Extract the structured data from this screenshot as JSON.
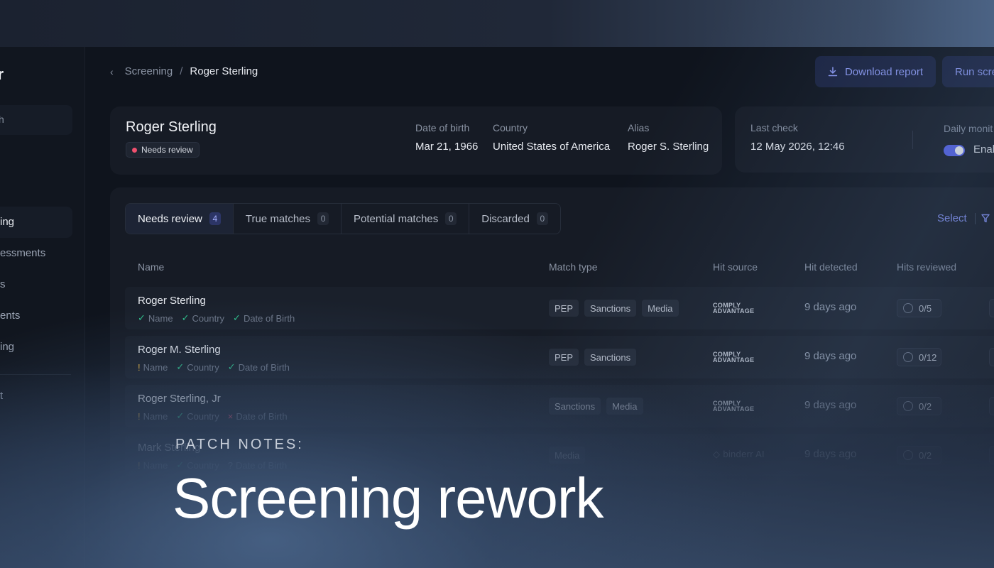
{
  "sidebar": {
    "logo": "rr",
    "search": "h",
    "items": [
      {
        "label": "ing",
        "active": true
      },
      {
        "label": "essments",
        "active": false
      },
      {
        "label": "s",
        "active": false
      },
      {
        "label": "ents",
        "active": false
      },
      {
        "label": "ing",
        "active": false
      }
    ],
    "footer_item": "t"
  },
  "breadcrumb": {
    "parent": "Screening",
    "separator": "/",
    "current": "Roger Sterling"
  },
  "actions": {
    "download": "Download report",
    "run": "Run scre"
  },
  "person": {
    "name": "Roger Sterling",
    "status": "Needs review",
    "fields": [
      {
        "label": "Date of birth",
        "value": "Mar 21, 1966"
      },
      {
        "label": "Country",
        "value": "United States of America"
      },
      {
        "label": "Alias",
        "value": "Roger S. Sterling"
      }
    ]
  },
  "check": {
    "last_check_label": "Last check",
    "last_check_value": "12 May 2026, 12:46",
    "monitor_label": "Daily monit",
    "monitor_toggle": "Enab"
  },
  "tabs": [
    {
      "label": "Needs review",
      "count": "4",
      "active": true
    },
    {
      "label": "True matches",
      "count": "0",
      "active": false
    },
    {
      "label": "Potential matches",
      "count": "0",
      "active": false
    },
    {
      "label": "Discarded",
      "count": "0",
      "active": false
    }
  ],
  "table_actions": {
    "select": "Select"
  },
  "columns": {
    "name": "Name",
    "match_type": "Match type",
    "hit_source": "Hit source",
    "hit_detected": "Hit detected",
    "hits_reviewed": "Hits reviewed"
  },
  "rows": [
    {
      "name": "Roger Sterling",
      "meta": [
        {
          "icon": "✓",
          "cls": "ok",
          "label": "Name"
        },
        {
          "icon": "✓",
          "cls": "ok",
          "label": "Country"
        },
        {
          "icon": "✓",
          "cls": "ok",
          "label": "Date of Birth"
        }
      ],
      "tags": [
        "PEP",
        "Sanctions",
        "Media"
      ],
      "source": "COMPLY ADVANTAGE",
      "detected": "9 days ago",
      "reviewed": "0/5"
    },
    {
      "name": "Roger M. Sterling",
      "meta": [
        {
          "icon": "!",
          "cls": "warn",
          "label": "Name"
        },
        {
          "icon": "✓",
          "cls": "ok",
          "label": "Country"
        },
        {
          "icon": "✓",
          "cls": "ok",
          "label": "Date of Birth"
        }
      ],
      "tags": [
        "PEP",
        "Sanctions"
      ],
      "source": "COMPLY ADVANTAGE",
      "detected": "9 days ago",
      "reviewed": "0/12"
    },
    {
      "name": "Roger Sterling, Jr",
      "meta": [
        {
          "icon": "!",
          "cls": "warn",
          "label": "Name"
        },
        {
          "icon": "✓",
          "cls": "ok",
          "label": "Country"
        },
        {
          "icon": "×",
          "cls": "bad",
          "label": "Date of Birth"
        }
      ],
      "tags": [
        "Sanctions",
        "Media"
      ],
      "source": "COMPLY ADVANTAGE",
      "detected": "9 days ago",
      "reviewed": "0/2"
    },
    {
      "name": "Mark Sterling",
      "meta": [
        {
          "icon": "!",
          "cls": "warn",
          "label": "Name"
        },
        {
          "icon": "✓",
          "cls": "ok",
          "label": "Country"
        },
        {
          "icon": "?",
          "cls": "unk",
          "label": "Date of Birth"
        }
      ],
      "tags": [
        "Media"
      ],
      "source": "binderr AI",
      "detected": "9 days ago",
      "reviewed": "0/2"
    }
  ],
  "banner": {
    "label": "PATCH NOTES:",
    "title": "Screening rework"
  },
  "colors": {
    "accent": "#5865f2",
    "link": "#8592f5",
    "ok": "#2fc08a",
    "warn": "#e9b53f",
    "bad": "#f0506e"
  }
}
